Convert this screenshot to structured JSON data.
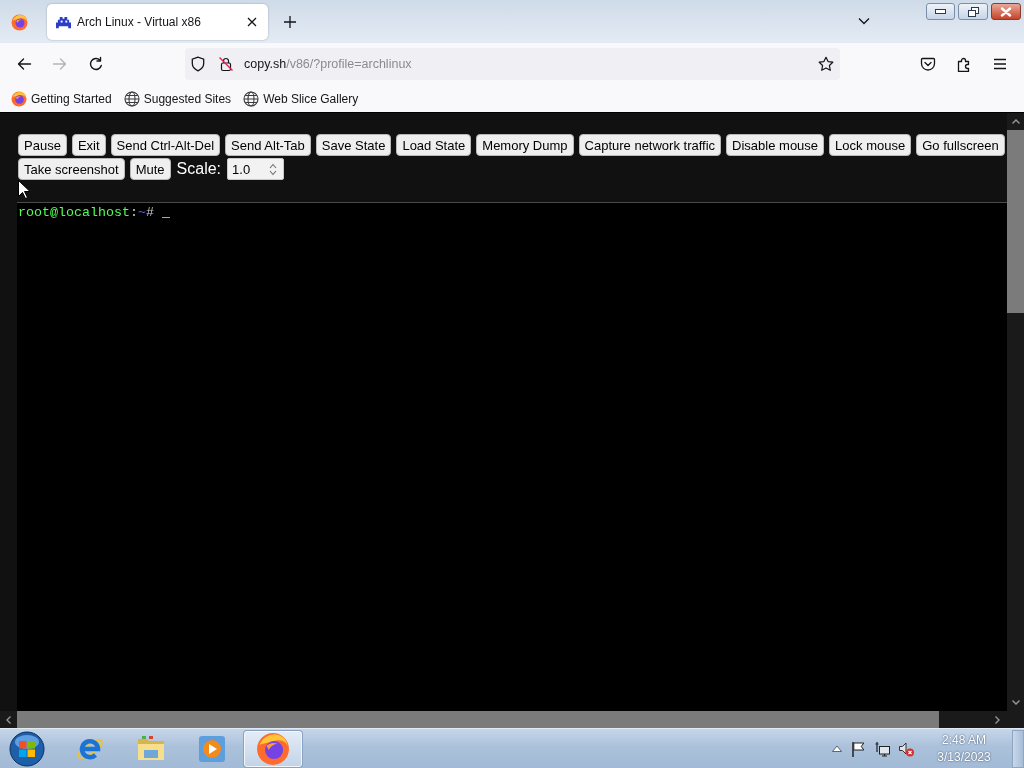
{
  "tabs": [
    {
      "title": "Arch Linux - Virtual x86",
      "selected": true
    }
  ],
  "nav_buttons": [
    {
      "kind": "back",
      "disabled": false
    },
    {
      "kind": "forward",
      "disabled": true
    },
    {
      "kind": "reload",
      "disabled": false
    }
  ],
  "address_bar": {
    "host": "copy.sh",
    "path": "/v86/?profile=archlinux"
  },
  "bookmarks": [
    {
      "kind": "firefox",
      "label": "Getting Started"
    },
    {
      "kind": "globe",
      "label": "Suggested Sites"
    },
    {
      "kind": "globe",
      "label": "Web Slice Gallery"
    }
  ],
  "emulator": {
    "button_rows": [
      [
        "Pause",
        "Exit",
        "Send Ctrl-Alt-Del",
        "Send Alt-Tab",
        "Save State",
        "Load State",
        "Memory Dump",
        "Capture network traffic",
        "Disable mouse",
        "Lock mouse",
        "Go fullscreen"
      ],
      [
        "Take screenshot",
        "Mute"
      ]
    ],
    "scale": {
      "label": "Scale:",
      "value": "1.0"
    },
    "terminal": {
      "lines": [
        {
          "user_host": "root@localhost",
          "separator": ":",
          "path": "~",
          "prompt": "#",
          "cursor": "_"
        }
      ]
    }
  },
  "taskbar": {
    "apps": [
      {
        "kind": "ie",
        "selected": false
      },
      {
        "kind": "explorer",
        "selected": false
      },
      {
        "kind": "media",
        "selected": false
      },
      {
        "kind": "firefox",
        "selected": true
      }
    ],
    "clock": {
      "time": "2:48 AM",
      "date": "3/13/2023"
    }
  }
}
